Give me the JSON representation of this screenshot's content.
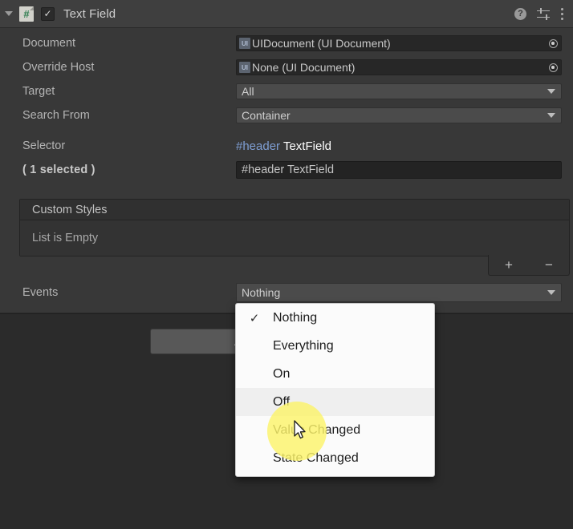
{
  "component": {
    "title": "Text Field",
    "enabled_check": "✓",
    "script_icon_glyph": "#",
    "foldout_state": "expanded",
    "header_icons": [
      "help-icon",
      "preset-icon",
      "more-menu-icon"
    ],
    "help_glyph": "?"
  },
  "properties": {
    "document": {
      "label": "Document",
      "value": "UIDocument (UI Document)",
      "thumb_text": "UI",
      "picker": "object-picker-icon"
    },
    "override_host": {
      "label": "Override Host",
      "value": "None (UI Document)",
      "thumb_text": "UI",
      "picker": "object-picker-icon"
    },
    "target": {
      "label": "Target",
      "value": "All"
    },
    "search_from": {
      "label": "Search From",
      "value": "Container"
    },
    "selector": {
      "label": "Selector",
      "preview_hash": "#header",
      "preview_class": "TextField",
      "count_label": "( 1 selected )",
      "input_value": "#header TextField"
    },
    "custom_styles": {
      "header": "Custom Styles",
      "empty_text": "List is Empty",
      "add_label": "+",
      "remove_label": "−"
    },
    "events": {
      "label": "Events",
      "value": "Nothing"
    }
  },
  "events_dropdown": {
    "items": [
      {
        "label": "Nothing",
        "checked": true,
        "hovered": false
      },
      {
        "label": "Everything",
        "checked": false,
        "hovered": false
      },
      {
        "label": "On",
        "checked": false,
        "hovered": false
      },
      {
        "label": "Off",
        "checked": false,
        "hovered": true
      },
      {
        "label": "Value Changed",
        "checked": false,
        "hovered": false
      },
      {
        "label": "State Changed",
        "checked": false,
        "hovered": false
      }
    ],
    "check_glyph": "✓"
  },
  "game_view": {
    "button_label": "A"
  },
  "colors": {
    "panel_bg": "#383838",
    "header_bg": "#3f3f3f",
    "lower_bg": "#2b2b2b",
    "field_bg": "#272727",
    "popup_bg": "#4b4b4b",
    "selector_hash": "#7f9fd4",
    "dropdown_bg": "#fbfbfb",
    "hover_row": "#efefef",
    "spotlight": "#fbf36a"
  }
}
